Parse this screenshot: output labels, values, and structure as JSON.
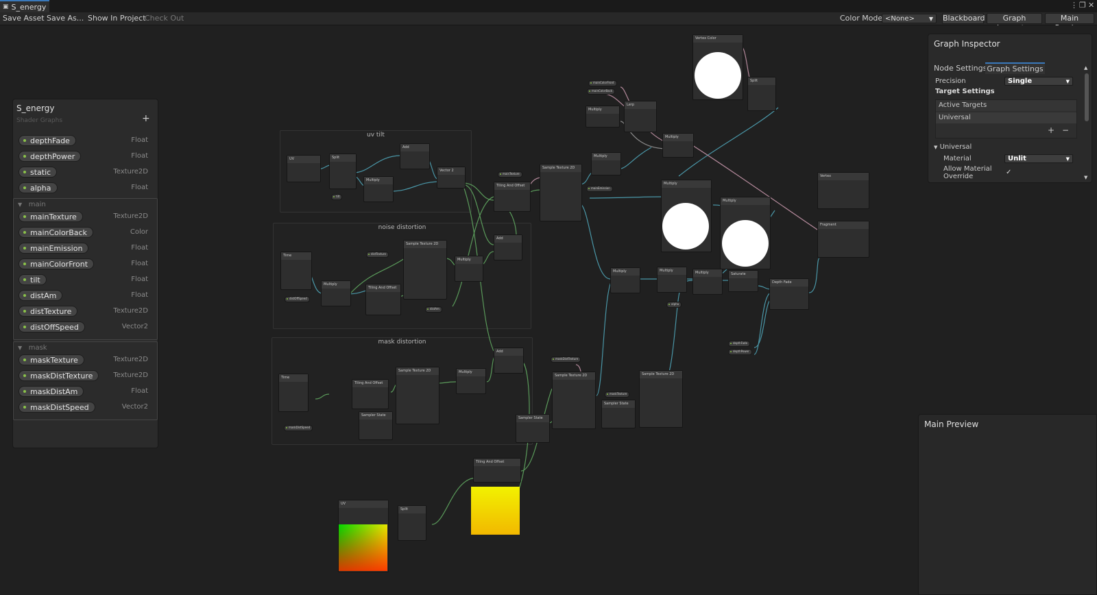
{
  "window": {
    "tab_title": "S_energy",
    "icons": [
      "shader-icon",
      "kebab-menu-icon",
      "maximize-icon",
      "close-icon"
    ]
  },
  "toolbar": {
    "save_asset": "Save Asset",
    "save_as": "Save As...",
    "show_in_project": "Show In Project",
    "check_out": "Check Out",
    "color_mode_label": "Color Mode",
    "color_mode_value": "<None>",
    "blackboard": "Blackboard",
    "graph_inspector": "Graph Inspector",
    "main_preview": "Main Preview"
  },
  "blackboard": {
    "title": "S_energy",
    "subtitle": "Shader Graphs",
    "properties": [
      {
        "name": "depthFade",
        "type": "Float"
      },
      {
        "name": "depthPower",
        "type": "Float"
      },
      {
        "name": "static",
        "type": "Texture2D"
      },
      {
        "name": "alpha",
        "type": "Float"
      }
    ],
    "categories": [
      {
        "name": "main",
        "properties": [
          {
            "name": "mainTexture",
            "type": "Texture2D"
          },
          {
            "name": "mainColorBack",
            "type": "Color"
          },
          {
            "name": "mainEmission",
            "type": "Float"
          },
          {
            "name": "mainColorFront",
            "type": "Float"
          },
          {
            "name": "tilt",
            "type": "Float"
          },
          {
            "name": "distAm",
            "type": "Float"
          },
          {
            "name": "distTexture",
            "type": "Texture2D"
          },
          {
            "name": "distOffSpeed",
            "type": "Vector2"
          }
        ]
      },
      {
        "name": "mask",
        "properties": [
          {
            "name": "maskTexture",
            "type": "Texture2D"
          },
          {
            "name": "maskDistTexture",
            "type": "Texture2D"
          },
          {
            "name": "maskDistAm",
            "type": "Float"
          },
          {
            "name": "maskDistSpeed",
            "type": "Vector2"
          }
        ]
      }
    ]
  },
  "inspector": {
    "title": "Graph Inspector",
    "tabs": [
      "Node Settings",
      "Graph Settings"
    ],
    "precision_label": "Precision",
    "precision_value": "Single",
    "target_settings": "Target Settings",
    "active_targets": "Active Targets",
    "target_item": "Universal",
    "add": "+",
    "remove": "−",
    "section": "Universal",
    "material_label": "Material",
    "material_value": "Unlit",
    "allow_override_label": "Allow Material Override",
    "allow_override_check": "✓"
  },
  "main_preview": {
    "title": "Main Preview"
  },
  "graph": {
    "groups": [
      {
        "title": "uv tilt"
      },
      {
        "title": "noise distortion"
      },
      {
        "title": "mask distortion"
      }
    ],
    "nodes": [
      "UV",
      "Split",
      "Add",
      "Multiply",
      "Vector 2",
      "Tiling And Offset",
      "Sample Texture 2D",
      "Time",
      "Multiply",
      "Tiling And Offset",
      "Sample Texture 2D",
      "Multiply",
      "Add",
      "Time",
      "Tiling And Offset",
      "Sample Texture 2D",
      "Multiply",
      "Add",
      "Sampler State",
      "Sample Texture 2D",
      "Sampler State",
      "Multiply",
      "Multiply",
      "Lerp",
      "Multiply",
      "Vertex Color",
      "Split",
      "Multiply",
      "Multiply",
      "Multiply",
      "Multiply",
      "Multiply",
      "Saturate",
      "Depth Fade",
      "Sample Texture 2D",
      "Sampler State",
      "Tiling And Offset",
      "UV",
      "Split",
      "Vertex",
      "Fragment"
    ],
    "pills": [
      "mainColorFront",
      "mainColorBack",
      "mainTexture",
      "mainEmission",
      "tilt",
      "distTexture",
      "distOffSpeed",
      "distAm",
      "maskDistSpeed",
      "maskDistTexture",
      "maskTexture",
      "alpha",
      "depthFade",
      "depthPower",
      "maskDistAm",
      "static"
    ],
    "colors": {
      "wire_green": "#5a9a5a",
      "wire_teal": "#4a97a8",
      "wire_pink": "#b58a9c",
      "wire_gray": "#8a8a8a"
    }
  }
}
